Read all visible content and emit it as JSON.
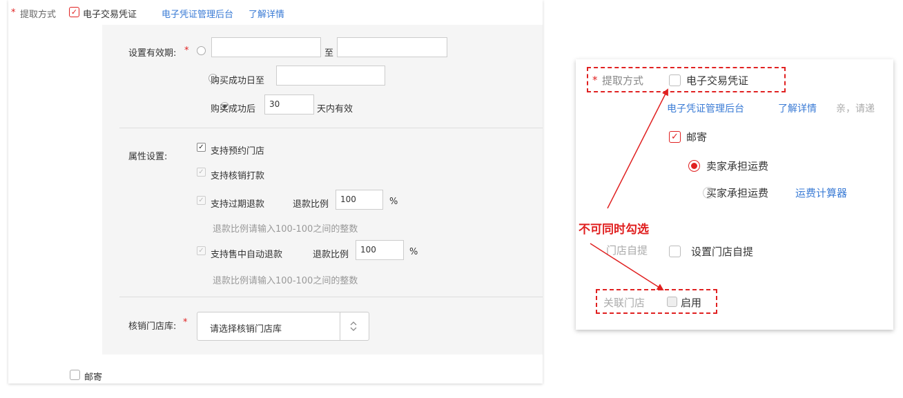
{
  "left": {
    "extract_label": "提取方式",
    "required_mark": "*",
    "voucher_label": "电子交易凭证",
    "admin_link": "电子凭证管理后台",
    "learn_more_link": "了解详情",
    "validity": {
      "label": "设置有效期:",
      "required_mark": "*",
      "to_label": "至",
      "from_value": "",
      "to_value": "",
      "option2_label": "购买成功日至",
      "option2_value": "",
      "option3_prefix": "购买成功后",
      "option3_days": "30",
      "option3_suffix": "天内有效"
    },
    "attributes": {
      "label": "属性设置:",
      "store_booking": "支持预约门店",
      "verify_payout": "支持核销打款",
      "expired_refund": "支持过期退款",
      "refund_ratio_label": "退款比例",
      "expired_refund_ratio": "100",
      "percent": "%",
      "hint1": "退款比例请输入100-100之间的整数",
      "auto_refund": "支持售中自动退款",
      "auto_refund_ratio": "100",
      "hint2": "退款比例请输入100-100之间的整数"
    },
    "store_library": {
      "label": "核销门店库:",
      "required_mark": "*",
      "placeholder": "请选择核销门店库"
    },
    "mail_label": "邮寄"
  },
  "right": {
    "extract_label": "提取方式",
    "required_mark": "*",
    "voucher_label": "电子交易凭证",
    "admin_link": "电子凭证管理后台",
    "learn_more_link": "了解详情",
    "trailing_text": "亲，请递",
    "mail_label": "邮寄",
    "seller_shipping": "卖家承担运费",
    "buyer_shipping": "买家承担运费",
    "shipping_calc_link": "运费计算器",
    "store_pickup_label": "门店自提",
    "set_store_pickup": "设置门店自提",
    "linked_store_label": "关联门店",
    "enable_label": "启用"
  },
  "annotation": {
    "text": "不可同时勾选",
    "color": "#e02020"
  },
  "icons": {
    "checkmark": "✓",
    "updown": "up-down-chevron-icon"
  }
}
